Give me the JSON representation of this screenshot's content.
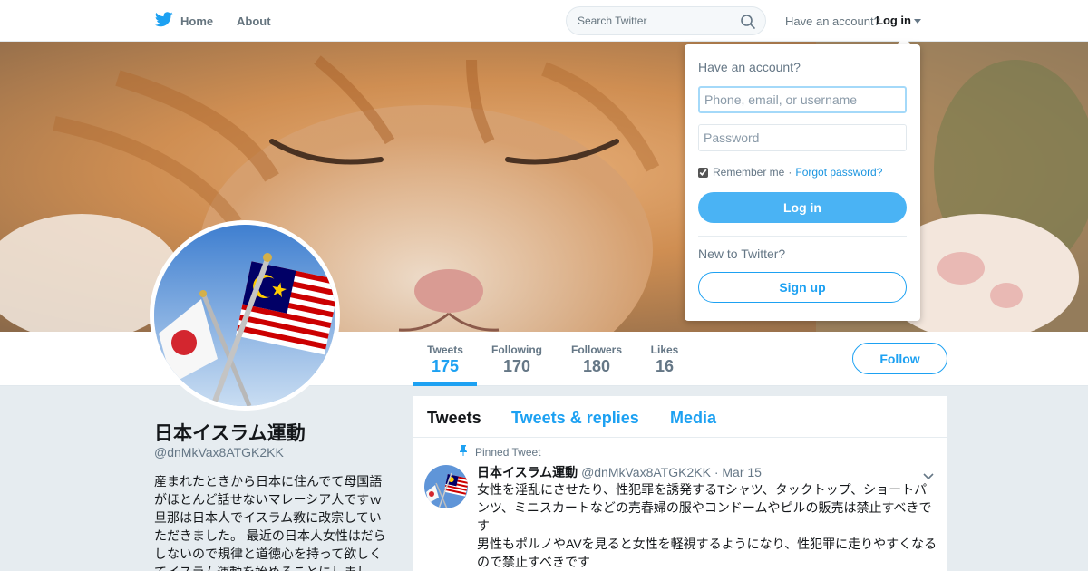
{
  "colors": {
    "accent": "#1da1f2",
    "text": "#14171a",
    "muted": "#657786",
    "background": "#e6ecf0"
  },
  "nav": {
    "home_label": "Home",
    "about_label": "About",
    "search_placeholder": "Search Twitter",
    "have_account_label": "Have an account?",
    "login_label": "Log in",
    "icons": [
      "twitter-bird-icon",
      "search-icon",
      "caret-down-icon"
    ]
  },
  "banner": {
    "image": "sleeping-orange-cat"
  },
  "profile": {
    "name": "日本イスラム運動",
    "handle": "@dnMkVax8ATGK2KK",
    "avatar_image": "japanese-and-malaysian-flags",
    "bio": "産まれたときから日本に住んでて母国語がほとんど話せないマレーシア人ですｗ旦那は日本人でイスラム教に改宗していただきました。 最近の日本人女性はだらしないので規律と道徳心を持って欲しくてイスラム運動を始めることにしまし"
  },
  "stats": [
    {
      "label": "Tweets",
      "value": "175",
      "active": true
    },
    {
      "label": "Following",
      "value": "170",
      "active": false
    },
    {
      "label": "Followers",
      "value": "180",
      "active": false
    },
    {
      "label": "Likes",
      "value": "16",
      "active": false
    }
  ],
  "follow_label": "Follow",
  "tabs": [
    {
      "label": "Tweets",
      "active": true
    },
    {
      "label": "Tweets & replies",
      "active": false
    },
    {
      "label": "Media",
      "active": false
    }
  ],
  "tweet": {
    "pinned_label": "Pinned Tweet",
    "name": "日本イスラム運動",
    "handle": "@dnMkVax8ATGK2KK",
    "separator": "·",
    "date": "Mar 15",
    "text_line1": "女性を淫乱にさせたり、性犯罪を誘発するTシャツ、タックトップ、ショートパンツ、ミニスカートなどの売春婦の服やコンドームやピルの販売は禁止すべきです",
    "text_line2": "男性もポルノやAVを見ると女性を軽視するようになり、性犯罪に走りやすくなるので禁止すべきです"
  },
  "login_dropdown": {
    "title": "Have an account?",
    "username_placeholder": "Phone, email, or username",
    "password_placeholder": "Password",
    "remember_label": "Remember me",
    "separator": "·",
    "forgot_label": "Forgot password?",
    "remember_checked": true,
    "login_button": "Log in",
    "new_prompt": "New to Twitter?",
    "signup_button": "Sign up"
  }
}
